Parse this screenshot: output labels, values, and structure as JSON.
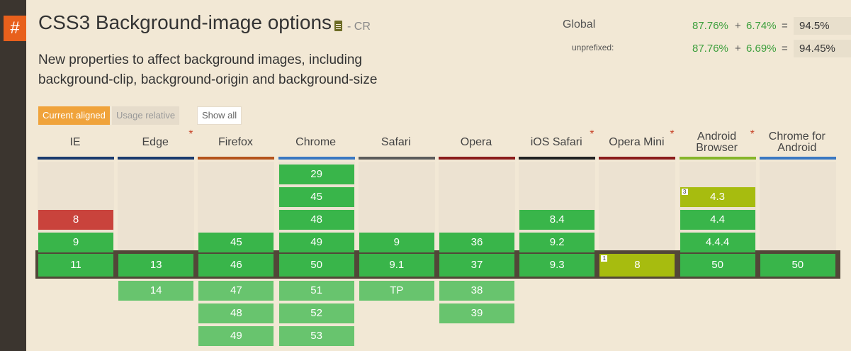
{
  "feature": {
    "anchor": "#",
    "title": "CSS3 Background-image options",
    "status": "- CR",
    "description": "New properties to affect background images, including background-clip, background-origin and background-size"
  },
  "stats": {
    "global": {
      "label": "Global",
      "supported": "87.76%",
      "partial": "6.74%",
      "total": "94.5%"
    },
    "unprefixed": {
      "label": "unprefixed:",
      "supported": "87.76%",
      "partial": "6.69%",
      "total": "94.45%"
    },
    "plus": "+",
    "equals": "="
  },
  "modes": {
    "current": "Current aligned",
    "usage": "Usage relative",
    "show_all": "Show all"
  },
  "browsers": [
    {
      "name": "IE",
      "bar": "#1b3b6f",
      "asterisk": false,
      "above": [
        {
          "v": "8",
          "s": "n"
        },
        {
          "v": "9",
          "s": "y"
        }
      ],
      "current": {
        "v": "11",
        "s": "y"
      },
      "below": []
    },
    {
      "name": "Edge",
      "bar": "#1b3b6f",
      "asterisk": true,
      "above": [],
      "current": {
        "v": "13",
        "s": "y"
      },
      "below": [
        {
          "v": "14",
          "s": "f"
        }
      ]
    },
    {
      "name": "Firefox",
      "bar": "#b5541c",
      "asterisk": false,
      "above": [
        {
          "v": "45",
          "s": "y"
        }
      ],
      "current": {
        "v": "46",
        "s": "y"
      },
      "below": [
        {
          "v": "47",
          "s": "f"
        },
        {
          "v": "48",
          "s": "f"
        },
        {
          "v": "49",
          "s": "f"
        }
      ]
    },
    {
      "name": "Chrome",
      "bar": "#3a78c2",
      "asterisk": false,
      "above": [
        {
          "v": "29",
          "s": "y"
        },
        {
          "v": "45",
          "s": "y"
        },
        {
          "v": "48",
          "s": "y"
        },
        {
          "v": "49",
          "s": "y"
        }
      ],
      "current": {
        "v": "50",
        "s": "y"
      },
      "below": [
        {
          "v": "51",
          "s": "f"
        },
        {
          "v": "52",
          "s": "f"
        },
        {
          "v": "53",
          "s": "f"
        }
      ]
    },
    {
      "name": "Safari",
      "bar": "#5c5c5c",
      "asterisk": false,
      "above": [
        {
          "v": "9",
          "s": "y"
        }
      ],
      "current": {
        "v": "9.1",
        "s": "y"
      },
      "below": [
        {
          "v": "TP",
          "s": "f"
        }
      ]
    },
    {
      "name": "Opera",
      "bar": "#8b1c1c",
      "asterisk": false,
      "above": [
        {
          "v": "36",
          "s": "y"
        }
      ],
      "current": {
        "v": "37",
        "s": "y"
      },
      "below": [
        {
          "v": "38",
          "s": "f"
        },
        {
          "v": "39",
          "s": "f"
        }
      ]
    },
    {
      "name": "iOS Safari",
      "bar": "#222222",
      "asterisk": true,
      "above": [
        {
          "v": "8.4",
          "s": "y"
        },
        {
          "v": "9.2",
          "s": "y"
        }
      ],
      "current": {
        "v": "9.3",
        "s": "y"
      },
      "below": []
    },
    {
      "name": "Opera Mini",
      "bar": "#8b1c1c",
      "asterisk": true,
      "above": [],
      "current": {
        "v": "8",
        "s": "a",
        "note": "1"
      },
      "below": []
    },
    {
      "name": "Android Browser",
      "bar": "#86b52a",
      "asterisk": true,
      "above": [
        {
          "v": "4.3",
          "s": "a",
          "note": "3"
        },
        {
          "v": "4.4",
          "s": "y"
        },
        {
          "v": "4.4.4",
          "s": "y"
        }
      ],
      "current": {
        "v": "50",
        "s": "y"
      },
      "below": []
    },
    {
      "name": "Chrome for Android",
      "bar": "#3a78c2",
      "asterisk": false,
      "above": [],
      "current": {
        "v": "50",
        "s": "y"
      },
      "below": []
    }
  ],
  "colors": {
    "y": "#39b54a",
    "n": "#c9433c",
    "a": "#a7bc0f",
    "f": "#68c46e"
  }
}
